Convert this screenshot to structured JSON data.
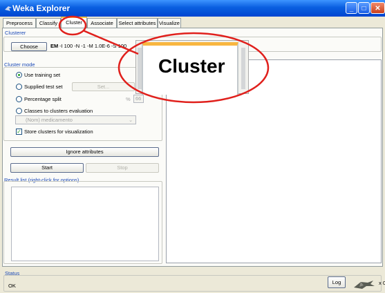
{
  "window": {
    "title": "Weka Explorer"
  },
  "tabs": [
    "Preprocess",
    "Classify",
    "Cluster",
    "Associate",
    "Select attributes",
    "Visualize"
  ],
  "clusterer": {
    "section_title": "Clusterer",
    "choose_label": "Choose",
    "algorithm": "EM",
    "options": "-I 100 -N -1 -M 1.0E-6 -S 100"
  },
  "cluster_mode": {
    "section_title": "Cluster mode",
    "use_training": "Use training set",
    "supplied_test": "Supplied test set",
    "set_label": "Set...",
    "percentage_split": "Percentage split",
    "percent_sign": "%",
    "percent_value": "66",
    "classes_eval": "Classes to clusters evaluation",
    "class_attr": "(Nom) medicamento",
    "store_clusters": "Store clusters for visualization"
  },
  "ignore_attributes_label": "Ignore attributes",
  "start_label": "Start",
  "stop_label": "Stop",
  "result_list": {
    "section_title": "Result list (right-click for options)"
  },
  "status": {
    "section_title": "Status",
    "text": "OK",
    "log_label": "Log",
    "x_count": "x 0"
  },
  "zoom_callout": {
    "text": "Cluster"
  },
  "colors": {
    "accent": "#0a5fe0",
    "highlight_circle": "#e0201c",
    "tab_active_border": "#ffc83c"
  }
}
